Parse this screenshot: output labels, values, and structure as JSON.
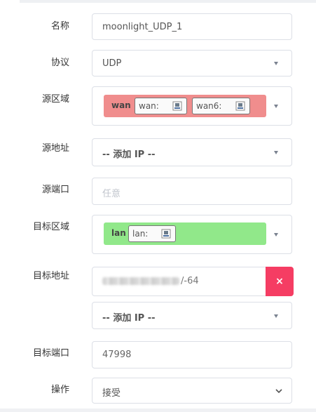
{
  "form": {
    "name": {
      "label": "名称",
      "value": "moonlight_UDP_1"
    },
    "protocol": {
      "label": "协议",
      "value": "UDP"
    },
    "src_zone": {
      "label": "源区域",
      "zone": "wan",
      "devices": [
        "wan:",
        "wan6:"
      ]
    },
    "src_addr": {
      "label": "源地址",
      "value": "-- 添加 IP --"
    },
    "src_port": {
      "label": "源端口",
      "placeholder": "任意"
    },
    "dest_zone": {
      "label": "目标区域",
      "zone": "lan",
      "devices": [
        "lan:"
      ]
    },
    "dest_addr": {
      "label": "目标地址",
      "value_suffix": "/-64",
      "delete_label": "×",
      "add_value": "-- 添加 IP --"
    },
    "dest_port": {
      "label": "目标端口",
      "value": "47998"
    },
    "action": {
      "label": "操作",
      "value": "接受"
    }
  },
  "colors": {
    "wan_zone": "#f08d8d",
    "lan_zone": "#91e88a",
    "delete_button": "#f53d63"
  },
  "icons": {
    "network_device": "ethernet-port-icon",
    "dropdown": "caret-down-icon"
  }
}
